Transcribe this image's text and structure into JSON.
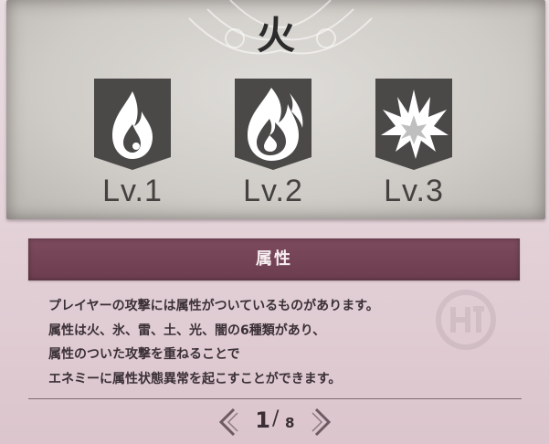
{
  "element_title": "火",
  "levels": [
    {
      "label": "Lv.1",
      "icon": "flame-lv1-icon"
    },
    {
      "label": "Lv.2",
      "icon": "flame-lv2-icon"
    },
    {
      "label": "Lv.3",
      "icon": "explosion-lv3-icon"
    }
  ],
  "section_title": "属性",
  "description": [
    "プレイヤーの攻撃には属性がついているものがあります。",
    "属性は火、氷、雷、土、光、闇の6種類があり、",
    "属性のついた攻撃を重ねることで",
    "エネミーに属性状態異常を起こすことができます。"
  ],
  "pagination": {
    "current": "1",
    "separator": "/",
    "total": "8"
  },
  "colors": {
    "banner": "#72404f",
    "badge": "#4a4948",
    "panel": "#d2cfca"
  }
}
